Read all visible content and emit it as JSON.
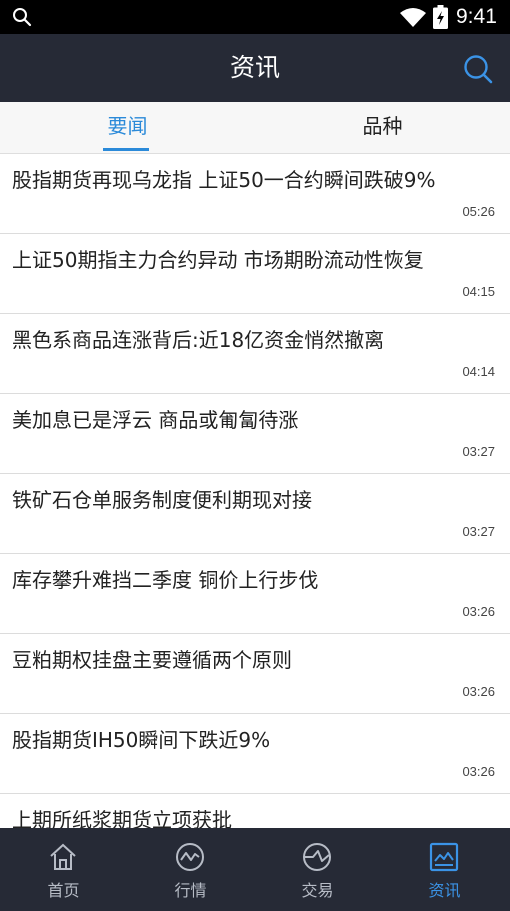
{
  "status_bar": {
    "time": "9:41",
    "icons": [
      "search-icon",
      "wifi-icon",
      "battery-icon"
    ]
  },
  "header": {
    "title": "资讯",
    "search_icon": "search-icon"
  },
  "tabs": [
    {
      "label": "要闻",
      "active": true
    },
    {
      "label": "品种",
      "active": false
    }
  ],
  "news": [
    {
      "headline": "股指期货再现乌龙指 上证50一合约瞬间跌破9%",
      "time": "05:26"
    },
    {
      "headline": "上证50期指主力合约异动 市场期盼流动性恢复",
      "time": "04:15"
    },
    {
      "headline": "黑色系商品连涨背后:近18亿资金悄然撤离",
      "time": "04:14"
    },
    {
      "headline": "美加息已是浮云 商品或匍匐待涨",
      "time": "03:27"
    },
    {
      "headline": "铁矿石仓单服务制度便利期现对接",
      "time": "03:27"
    },
    {
      "headline": "库存攀升难挡二季度 铜价上行步伐",
      "time": "03:26"
    },
    {
      "headline": "豆粕期权挂盘主要遵循两个原则",
      "time": "03:26"
    },
    {
      "headline": "股指期货IH50瞬间下跌近9%",
      "time": "03:26"
    },
    {
      "headline": "上期所纸浆期货立项获批",
      "time": ""
    }
  ],
  "bottom_nav": [
    {
      "label": "首页",
      "icon": "home-icon",
      "active": false
    },
    {
      "label": "行情",
      "icon": "chart-icon",
      "active": false
    },
    {
      "label": "交易",
      "icon": "trade-icon",
      "active": false
    },
    {
      "label": "资讯",
      "icon": "news-icon",
      "active": true
    }
  ],
  "colors": {
    "accent": "#2b8ad9",
    "header_bg": "#262a36",
    "status_bg": "#000000"
  }
}
